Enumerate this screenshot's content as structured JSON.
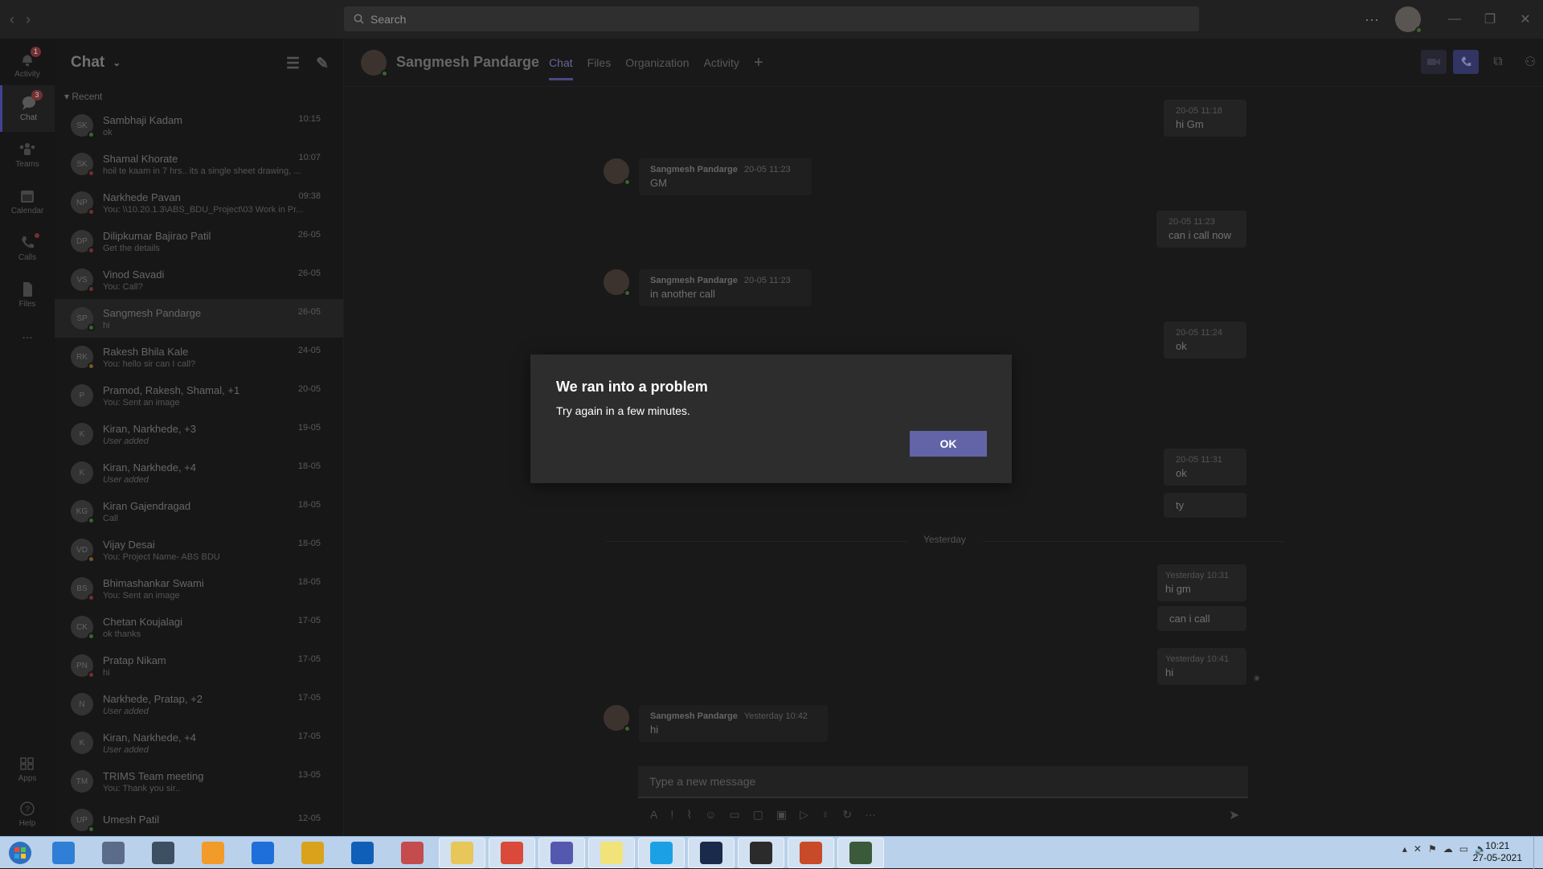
{
  "search": {
    "placeholder": "Search"
  },
  "rail": [
    {
      "label": "Activity",
      "badge": "1"
    },
    {
      "label": "Chat",
      "badge": "3"
    },
    {
      "label": "Teams"
    },
    {
      "label": "Calendar"
    },
    {
      "label": "Calls"
    },
    {
      "label": "Files"
    },
    {
      "label": "..."
    },
    {
      "label": "Apps"
    },
    {
      "label": "Help"
    }
  ],
  "chatlist": {
    "title": "Chat",
    "section": "Recent",
    "items": [
      {
        "initials": "SK",
        "name": "Sambhaji Kadam",
        "preview": "ok",
        "time": "10:15",
        "status": "g",
        "italic": false
      },
      {
        "initials": "SK",
        "name": "Shamal Khorate",
        "preview": "hoil te kaam in 7 hrs.. its a single sheet drawing, ...",
        "time": "10:07",
        "status": "r",
        "italic": false
      },
      {
        "initials": "NP",
        "name": "Narkhede Pavan",
        "preview": "You: \\\\10.20.1.3\\ABS_BDU_Project\\03 Work in Pr...",
        "time": "09:38",
        "status": "r",
        "italic": false
      },
      {
        "initials": "DP",
        "name": "Dilipkumar Bajirao Patil",
        "preview": "Get the details",
        "time": "26-05",
        "status": "r",
        "italic": false
      },
      {
        "initials": "VS",
        "name": "Vinod Savadi",
        "preview": "You: Call?",
        "time": "26-05",
        "status": "r",
        "italic": false
      },
      {
        "initials": "SP",
        "name": "Sangmesh Pandarge",
        "preview": "hi",
        "time": "26-05",
        "status": "g",
        "italic": false
      },
      {
        "initials": "RK",
        "name": "Rakesh Bhila Kale",
        "preview": "You: hello sir can I call?",
        "time": "24-05",
        "status": "y",
        "italic": false
      },
      {
        "initials": "P",
        "name": "Pramod, Rakesh, Shamal, +1",
        "preview": "You: Sent an image",
        "time": "20-05",
        "status": "",
        "italic": false
      },
      {
        "initials": "K",
        "name": "Kiran, Narkhede, +3",
        "preview": "User added",
        "time": "19-05",
        "status": "",
        "italic": true
      },
      {
        "initials": "K",
        "name": "Kiran, Narkhede, +4",
        "preview": "User added",
        "time": "18-05",
        "status": "",
        "italic": true
      },
      {
        "initials": "KG",
        "name": "Kiran Gajendragad",
        "preview": "Call",
        "time": "18-05",
        "status": "g",
        "italic": false
      },
      {
        "initials": "VD",
        "name": "Vijay Desai",
        "preview": "You: Project Name- ABS BDU",
        "time": "18-05",
        "status": "y",
        "italic": false
      },
      {
        "initials": "BS",
        "name": "Bhimashankar Swami",
        "preview": "You: Sent an image",
        "time": "18-05",
        "status": "r",
        "italic": false
      },
      {
        "initials": "CK",
        "name": "Chetan Koujalagi",
        "preview": "ok thanks",
        "time": "17-05",
        "status": "g",
        "italic": false
      },
      {
        "initials": "PN",
        "name": "Pratap Nikam",
        "preview": "hi",
        "time": "17-05",
        "status": "r",
        "italic": false
      },
      {
        "initials": "N",
        "name": "Narkhede, Pratap, +2",
        "preview": "User added",
        "time": "17-05",
        "status": "",
        "italic": true
      },
      {
        "initials": "K",
        "name": "Kiran, Narkhede, +4",
        "preview": "User added",
        "time": "17-05",
        "status": "",
        "italic": true
      },
      {
        "initials": "TM",
        "name": "TRIMS Team meeting",
        "preview": "You: Thank you sir..",
        "time": "13-05",
        "status": "",
        "italic": false
      },
      {
        "initials": "UP",
        "name": "Umesh Patil",
        "preview": "",
        "time": "12-05",
        "status": "g",
        "italic": false
      }
    ]
  },
  "conversation": {
    "name": "Sangmesh Pandarge",
    "tabs": [
      "Chat",
      "Files",
      "Organization",
      "Activity"
    ],
    "messages_mine": [
      {
        "time": "20-05 11:18",
        "text": "hi Gm"
      },
      {
        "time": "20-05 11:23",
        "text": "can i call now"
      },
      {
        "time": "20-05 11:24",
        "text": "ok"
      },
      {
        "time": "20-05 11:31",
        "text": "ok"
      },
      {
        "time": "",
        "text": "ty"
      },
      {
        "time": "Yesterday 10:31",
        "text": "hi gm"
      },
      {
        "time": "",
        "text": "can i call"
      },
      {
        "time": "Yesterday 10:41",
        "text": "hi"
      }
    ],
    "messages_other": [
      {
        "sender": "Sangmesh Pandarge",
        "time": "20-05 11:23",
        "text": "GM"
      },
      {
        "sender": "Sangmesh Pandarge",
        "time": "20-05 11:23",
        "text": "in another call"
      },
      {
        "sender": "Sangmesh Pandarge",
        "time": "Yesterday 10:42",
        "text": "hi"
      }
    ],
    "divider": "Yesterday",
    "compose_placeholder": "Type a new message"
  },
  "dialog": {
    "title": "We ran into a problem",
    "body": "Try again in a few minutes.",
    "ok": "OK"
  },
  "taskbar": {
    "apps": [
      {
        "name": "internet-explorer",
        "color": "#2f7fd6",
        "open": false
      },
      {
        "name": "system-tool",
        "color": "#5a6c8a",
        "open": false
      },
      {
        "name": "device-manager",
        "color": "#3d4f63",
        "open": false
      },
      {
        "name": "media-player",
        "color": "#f29b28",
        "open": false
      },
      {
        "name": "onedrive",
        "color": "#1e6fd9",
        "open": false
      },
      {
        "name": "3d-viewer",
        "color": "#d8a31a",
        "open": false
      },
      {
        "name": "outlook",
        "color": "#0f5fb8",
        "open": false
      },
      {
        "name": "paint",
        "color": "#c44c4c",
        "open": false
      },
      {
        "name": "file-explorer",
        "color": "#e7c65a",
        "open": true
      },
      {
        "name": "chrome",
        "color": "#d94a3a",
        "open": true
      },
      {
        "name": "teams",
        "color": "#5558af",
        "open": true
      },
      {
        "name": "sticky-notes",
        "color": "#f2e27a",
        "open": true
      },
      {
        "name": "skype",
        "color": "#1ba0e6",
        "open": true
      },
      {
        "name": "nx",
        "color": "#1a2a4a",
        "open": true
      },
      {
        "name": "snipping",
        "color": "#2b2b2b",
        "open": true
      },
      {
        "name": "powerpoint",
        "color": "#c94a28",
        "open": true
      },
      {
        "name": "monitor",
        "color": "#3a5a3a",
        "open": true
      }
    ],
    "time": "10:21",
    "date": "27-05-2021"
  }
}
